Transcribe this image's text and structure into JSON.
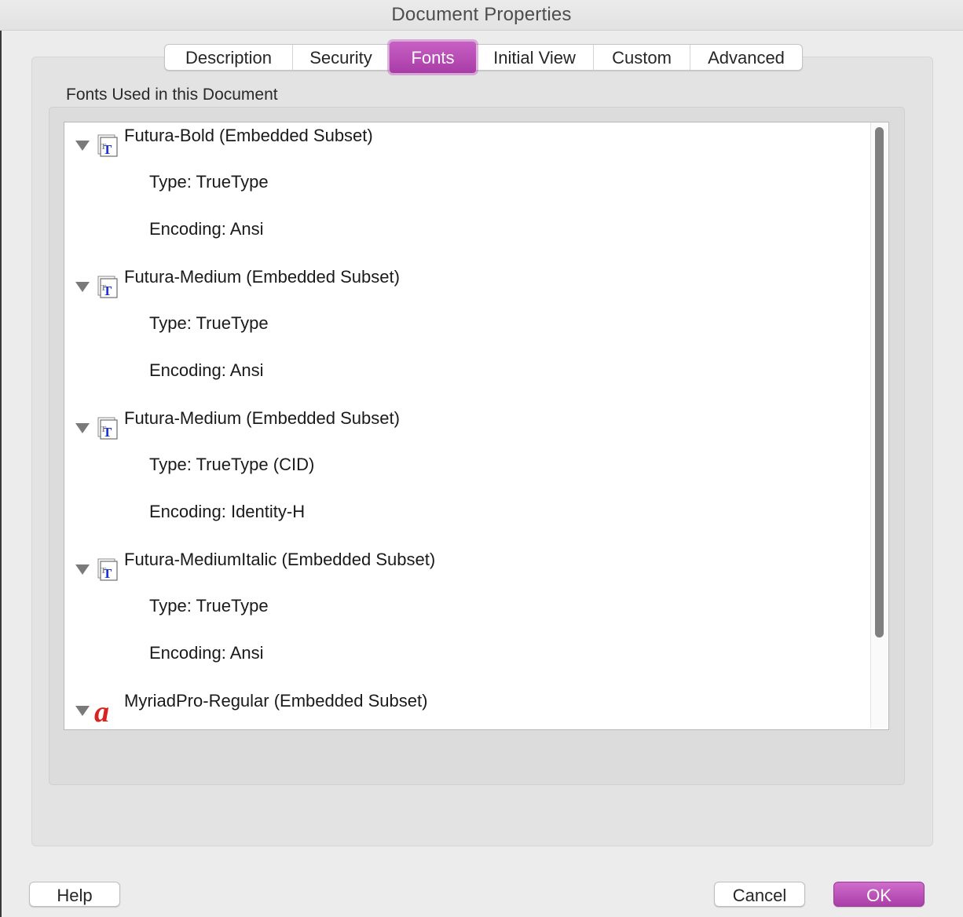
{
  "window": {
    "title": "Document Properties"
  },
  "tabs": [
    {
      "label": "Description",
      "active": false
    },
    {
      "label": "Security",
      "active": false
    },
    {
      "label": "Fonts",
      "active": true
    },
    {
      "label": "Initial View",
      "active": false
    },
    {
      "label": "Custom",
      "active": false
    },
    {
      "label": "Advanced",
      "active": false
    }
  ],
  "fonts_section": {
    "label": "Fonts Used in this Document",
    "fonts": [
      {
        "name": "Futura-Bold (Embedded Subset)",
        "icon": "truetype-font-icon",
        "type": "Type: TrueType",
        "encoding": "Encoding: Ansi"
      },
      {
        "name": "Futura-Medium (Embedded Subset)",
        "icon": "truetype-font-icon",
        "type": "Type: TrueType",
        "encoding": "Encoding: Ansi"
      },
      {
        "name": "Futura-Medium (Embedded Subset)",
        "icon": "truetype-font-icon",
        "type": "Type: TrueType (CID)",
        "encoding": "Encoding: Identity-H"
      },
      {
        "name": "Futura-MediumItalic (Embedded Subset)",
        "icon": "truetype-font-icon",
        "type": "Type: TrueType",
        "encoding": "Encoding: Ansi"
      },
      {
        "name": "MyriadPro-Regular (Embedded Subset)",
        "icon": "opentype-font-icon"
      }
    ]
  },
  "buttons": {
    "help": "Help",
    "cancel": "Cancel",
    "ok": "OK"
  },
  "colors": {
    "accent": "#b84bb6",
    "truetype_icon_blue": "#1a2fd6",
    "opentype_icon_red": "#d8231f"
  }
}
